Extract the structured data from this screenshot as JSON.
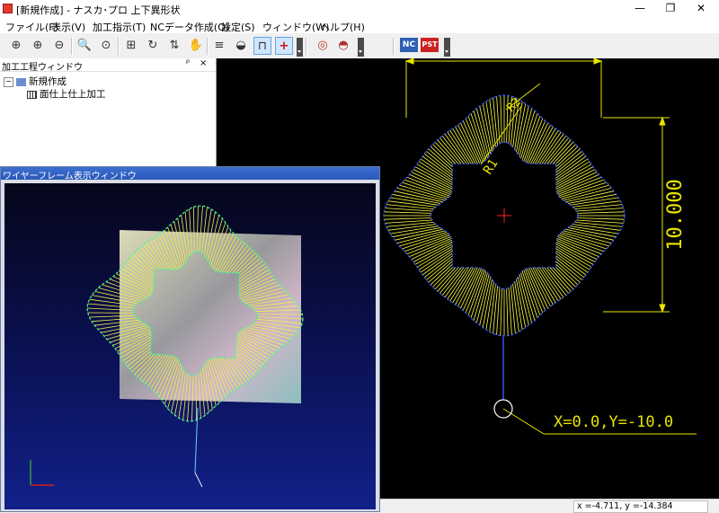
{
  "window": {
    "title": "[新規作成] - ナスカ･プロ 上下異形状",
    "minimize_glyph": "—",
    "maximize_glyph": "❐",
    "close_glyph": "✕"
  },
  "menu": {
    "items": [
      {
        "label": "ファイル(F)"
      },
      {
        "label": "表示(V)"
      },
      {
        "label": "加工指示(T)"
      },
      {
        "label": "NCデータ作成(O)"
      },
      {
        "label": "設定(S)"
      },
      {
        "label": "ウィンドウ(W)"
      },
      {
        "label": "ヘルプ(H)"
      }
    ]
  },
  "toolbar": {
    "buttons": [
      {
        "icon": "zoom-in-icon",
        "glyph": "⊕"
      },
      {
        "icon": "zoom-x2-icon",
        "glyph": "⊕"
      },
      {
        "icon": "zoom-half-icon",
        "glyph": "⊖"
      },
      {
        "icon": "zoom-window-icon",
        "glyph": "🔍"
      },
      {
        "icon": "zoom-fit-icon",
        "glyph": "⊙"
      },
      {
        "icon": "machine-icon",
        "glyph": "⊞"
      },
      {
        "icon": "refresh-icon",
        "glyph": "↻"
      },
      {
        "icon": "swap-icon",
        "glyph": "⇅"
      },
      {
        "icon": "pan-hand-icon",
        "glyph": "✋"
      },
      {
        "icon": "layer-icon",
        "glyph": "≡"
      },
      {
        "icon": "shell-icon",
        "glyph": "◒"
      },
      {
        "icon": "workpiece-icon",
        "glyph": "⊓"
      },
      {
        "icon": "origin-cross-icon",
        "glyph": "+"
      },
      {
        "icon": "target-icon",
        "glyph": "◎"
      },
      {
        "icon": "dome-icon",
        "glyph": "◓"
      }
    ],
    "nc_label": "NC",
    "pst_label": "PST"
  },
  "process_panel": {
    "title": "加工工程ウィンドウ",
    "pin_glyph": "ᵖ",
    "close_glyph": "×",
    "tree": {
      "root_label": "新規作成",
      "expander": "−",
      "child_label": "面仕上仕上加工"
    }
  },
  "cad_view": {
    "dimension_width_label": "10.000",
    "radius_big_label": "R1",
    "radius_small_label": "R2",
    "start_point_label": "X=0.0,Y=-10.0"
  },
  "wire_window": {
    "title": "ワイヤーフレーム表示ウィンドウ"
  },
  "status": {
    "coords": "x =-4.711,   y =-14.384"
  },
  "colors": {
    "cad_background": "#000000",
    "path_line": "#ffff44",
    "dimension": "#e8e400",
    "contour_blue": "#3a5aff",
    "origin_marker": "#ff2222"
  }
}
